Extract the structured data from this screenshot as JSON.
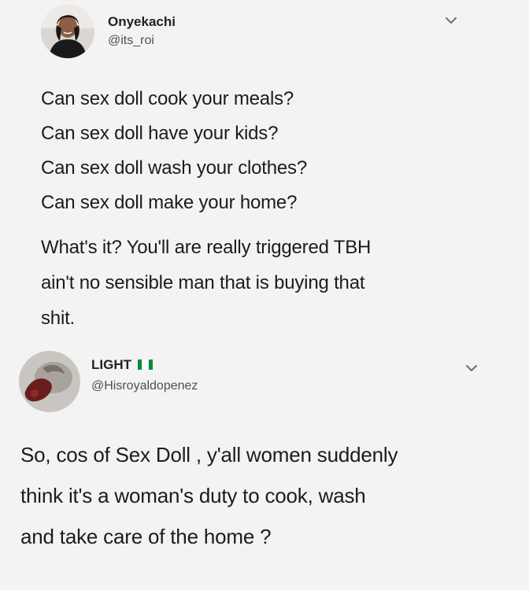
{
  "tweets": [
    {
      "author_name": "Onyekachi",
      "author_handle": "@its_roi",
      "paragraphs": [
        [
          "Can sex doll cook your meals?",
          "Can sex doll have your kids?",
          "Can sex doll wash your clothes?",
          "Can sex doll make your home?"
        ],
        [
          "What's it? You'll are really triggered TBH",
          "ain't no sensible man that is buying that",
          "shit."
        ]
      ]
    },
    {
      "author_name": "LIGHT",
      "author_handle": "@Hisroyaldopenez",
      "name_emoji": "nigeria-flag",
      "paragraphs": [
        [
          "So, cos of Sex Doll , y'all women suddenly",
          "think it's a woman's duty to cook, wash",
          "and take care of the home ?"
        ]
      ]
    }
  ],
  "colors": {
    "background": "#f3f3f3",
    "text": "#1c1c1c",
    "handle": "#4f4f4f",
    "flag_green": "#0b8a3e"
  },
  "icons": [
    "chevron-down-icon",
    "avatar",
    "nigeria-flag-icon"
  ]
}
